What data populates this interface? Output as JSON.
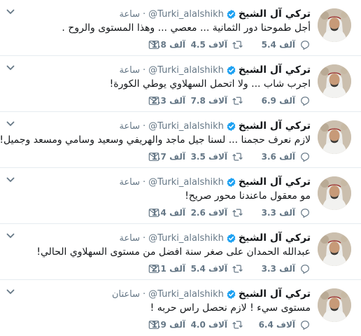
{
  "tweets": [
    {
      "name": "تركي آل الشيخ",
      "handle": "@Turki_alalshikh",
      "time": "ساعة",
      "text": "أجل طموحنا دور الثمانية ... معصي ... وهذا المستوى والروح .",
      "replies": "5.4 آلف",
      "retweets": "4.5 آلاف",
      "likes": "1.8 آلف"
    },
    {
      "name": "تركي آل الشيخ",
      "handle": "@Turki_alalshikh",
      "time": "ساعة",
      "text": "اجرب شاب ... ولا اتحمل السهلاوي يوطي الكورة!",
      "replies": "6.9 آلف",
      "retweets": "7.8 آلاف",
      "likes": "2.3 آلف"
    },
    {
      "name": "تركي آل الشيخ",
      "handle": "@Turki_alalshikh",
      "time": "ساعة",
      "text": "لازم نعرف حجمنا ... لسنا جيل ماجد والهريفي وسعيد وسامي ومسعد وجميل!",
      "replies": "3.6 آلف",
      "retweets": "3.5 آلاف",
      "likes": "1.7 آلف"
    },
    {
      "name": "تركي آل الشيخ",
      "handle": "@Turki_alalshikh",
      "time": "ساعة",
      "text": "مو معقول ماعندنا محور صريح!",
      "replies": "3.3 آلف",
      "retweets": "2.6 آلاف",
      "likes": "1.4 آلف"
    },
    {
      "name": "تركي آل الشيخ",
      "handle": "@Turki_alalshikh",
      "time": "ساعة",
      "text": "عبدالله الحمدان على صغر سنة افضل من مستوى السهلاوي الحالي!",
      "replies": "3.3 آلف",
      "retweets": "5.4 آلاف",
      "likes": "2.1 آلف"
    },
    {
      "name": "تركي آل الشيخ",
      "handle": "@Turki_alalshikh",
      "time": "ساعتان",
      "text": "مستوى سيء ! لازم نحصل راس حربه !",
      "replies": "6.4 آلاف",
      "retweets": "4.0 آلاف",
      "likes": "1.9 آلف"
    }
  ],
  "colors": {
    "verified": "#1da1f2",
    "muted": "#657786",
    "text": "#14171a",
    "divider": "#e6ecf0"
  },
  "icons": [
    "verified-badge-icon",
    "chevron-down-icon",
    "reply-icon",
    "retweet-icon",
    "like-icon",
    "message-icon"
  ]
}
